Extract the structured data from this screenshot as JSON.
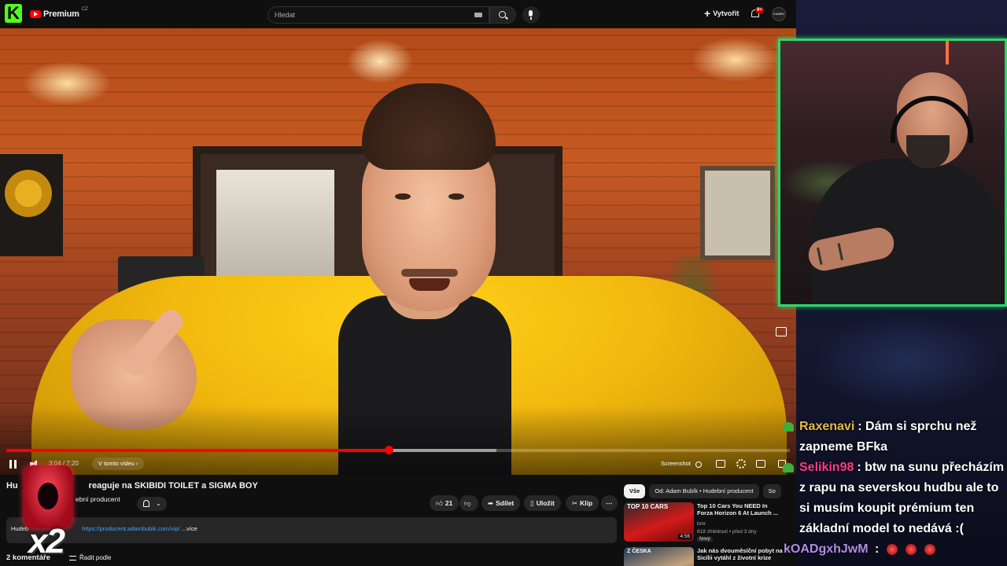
{
  "topbar": {
    "logo_text": "Premium",
    "logo_sup": "CZ",
    "search_placeholder": "Hledat",
    "create_label": "Vytvořit",
    "notif_count": "9+",
    "avatar_text": "ZAMEK"
  },
  "player": {
    "time": "3:04 / 7:20",
    "progress_fraction": 0.488,
    "buffer_fraction": 0.626,
    "chip_label": "V tomto videu ›",
    "screenshot_label": "Screenshot"
  },
  "video": {
    "title": "Hu... reaguje na SKIBIDI TOILET a SIGMA BOY",
    "title_visible": "Hu",
    "title_rest": "reaguje na SKIBIDI TOILET a SIGMA BOY",
    "channel": "ební producent",
    "likes": "21",
    "share_label": "Sdílet",
    "save_label": "Uložit",
    "clip_label": "Klip",
    "description_prefix": "Hudeb",
    "description_link": "https://producent.adambubik.com/vip/",
    "description_more": "...více",
    "comments_label": "2 komentáře",
    "sort_label": "Řadit podle"
  },
  "recommendations": {
    "chips": [
      "Vše",
      "Od: Adam Bubík • Hudební producent",
      "So"
    ],
    "items": [
      {
        "title": "Top 10 Cars You NEED In Forza Horizon 6 At Launch ...",
        "channel": "bmr",
        "meta": "618 zhlédnutí  •  před 3 dny",
        "badge": "Nový",
        "duration": "4:56",
        "thumb_text": "TOP 10 CARS"
      },
      {
        "title": "Jak nás dvouměsíční pobyt na Sicílii vytáhl z životní krize",
        "thumb_text": "Z ČESKA"
      }
    ]
  },
  "chat": {
    "messages": [
      {
        "user": "Raxenavi",
        "color": "#e6b84a",
        "text": ": Dám si sprchu než zapneme BFka"
      },
      {
        "user": "Selikin98",
        "color": "#ff3b8a",
        "text": ": btw na sunu přecházím z rapu na severskou hudbu ale to si musím koupit prémium ten základní model to nedává :("
      },
      {
        "user": "kOADgxhJwM",
        "color": "#b08ce8",
        "text": " :"
      }
    ]
  },
  "overlay": {
    "multiplier": "x2"
  }
}
